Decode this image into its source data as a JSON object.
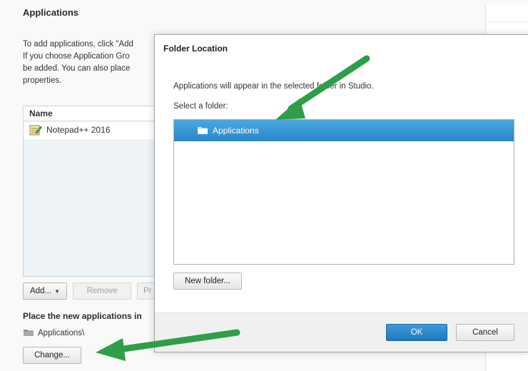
{
  "background": {
    "heading": "Applications",
    "description_lines": [
      "To add applications, click \"Add",
      "If you choose Application Gro",
      "be added. You can also place",
      "properties."
    ],
    "list": {
      "column_header": "Name",
      "items": [
        {
          "label": "Notepad++ 2016",
          "icon": "application-icon"
        }
      ]
    },
    "buttons": {
      "add": "Add...",
      "remove": "Remove",
      "partial": "Pr"
    },
    "place_label": "Place the new applications in",
    "current_folder": "Applications\\",
    "change_button": "Change..."
  },
  "dialog": {
    "title": "Folder Location",
    "info": "Applications will appear in the selected folder in Studio.",
    "select_label": "Select a folder:",
    "folders": [
      {
        "label": "Applications",
        "icon": "folder-icon",
        "selected": true
      }
    ],
    "new_folder_button": "New folder...",
    "ok_button": "OK",
    "cancel_button": "Cancel"
  },
  "colors": {
    "selection": "#2a86c8",
    "annotation_arrow": "#2e9e48",
    "primary_button": "#1f78bd"
  }
}
